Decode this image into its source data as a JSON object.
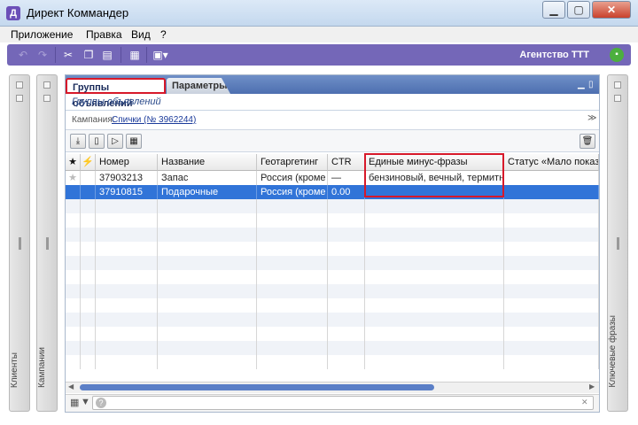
{
  "window": {
    "title": "Директ Коммандер",
    "app_icon_glyph": "Д"
  },
  "menu": [
    "Приложение",
    "Правка",
    "Вид",
    "?"
  ],
  "toolbar": {
    "agency": "Агентство ТТТ"
  },
  "side_panels": {
    "clients": "Клиенты",
    "campaigns": "Кампании",
    "keywords": "Ключевые фразы"
  },
  "tabs": {
    "groups": "Группы объявлений",
    "params": "Параметры"
  },
  "panel": {
    "subtitle": "Группы объявлений",
    "campaign_label": "Кампания:",
    "campaign_link": "Спички (№ 3962244)"
  },
  "grid": {
    "columns": [
      "★",
      "⚡",
      "Номер",
      "Название",
      "Геотаргетинг",
      "CTR",
      "Единые минус-фразы",
      "Статус «Мало показ…"
    ],
    "rows": [
      {
        "star": "★",
        "number": "37903213",
        "name": "Запас",
        "geo": "Россия (кроме F",
        "ctr": "—",
        "minus": "бензиновый, вечный, термитный",
        "status": "",
        "selected": false
      },
      {
        "star": "",
        "number": "37910815",
        "name": "Подарочные",
        "geo": "Россия (кроме F",
        "ctr": "0.00",
        "minus": "",
        "status": "",
        "selected": true
      }
    ]
  },
  "colors": {
    "toolbar": "#7467b8",
    "selection": "#3174d8",
    "highlight": "#d7192a",
    "tab_strip": "#5676b8"
  }
}
